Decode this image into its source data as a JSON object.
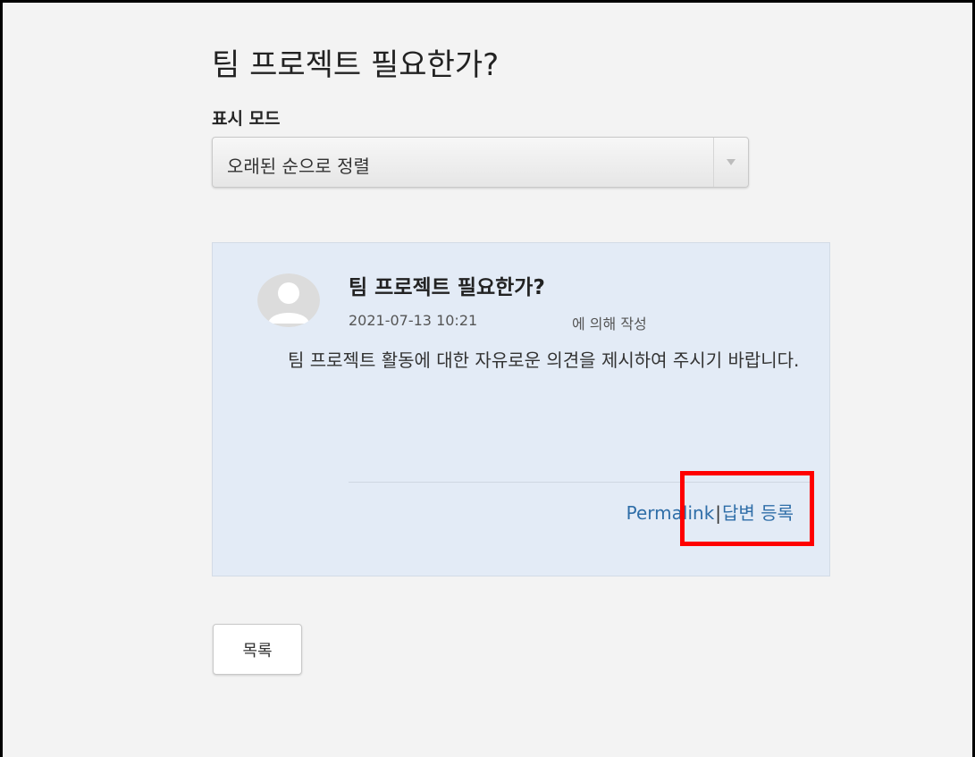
{
  "page": {
    "title": "팀 프로젝트 필요한가?"
  },
  "display_mode": {
    "label": "표시 모드",
    "selected": "오래된 순으로 정렬",
    "arrow_icon": "chevron-down-icon"
  },
  "post": {
    "title": "팀 프로젝트 필요한가?",
    "date": "2021-07-13 10:21",
    "author_suffix": "에 의해 작성",
    "body": "팀 프로젝트 활동에 대한 자유로운 의견을 제시하여 주시기 바랍니다.",
    "permalink_label": "Permalink",
    "separator": "|",
    "reply_label": "답변 등록",
    "avatar_icon": "user-avatar-icon"
  },
  "actions": {
    "list_label": "목록"
  },
  "colors": {
    "card_background": "#e3ebf6",
    "link": "#2f6ea8",
    "highlight": "#ff0000"
  }
}
